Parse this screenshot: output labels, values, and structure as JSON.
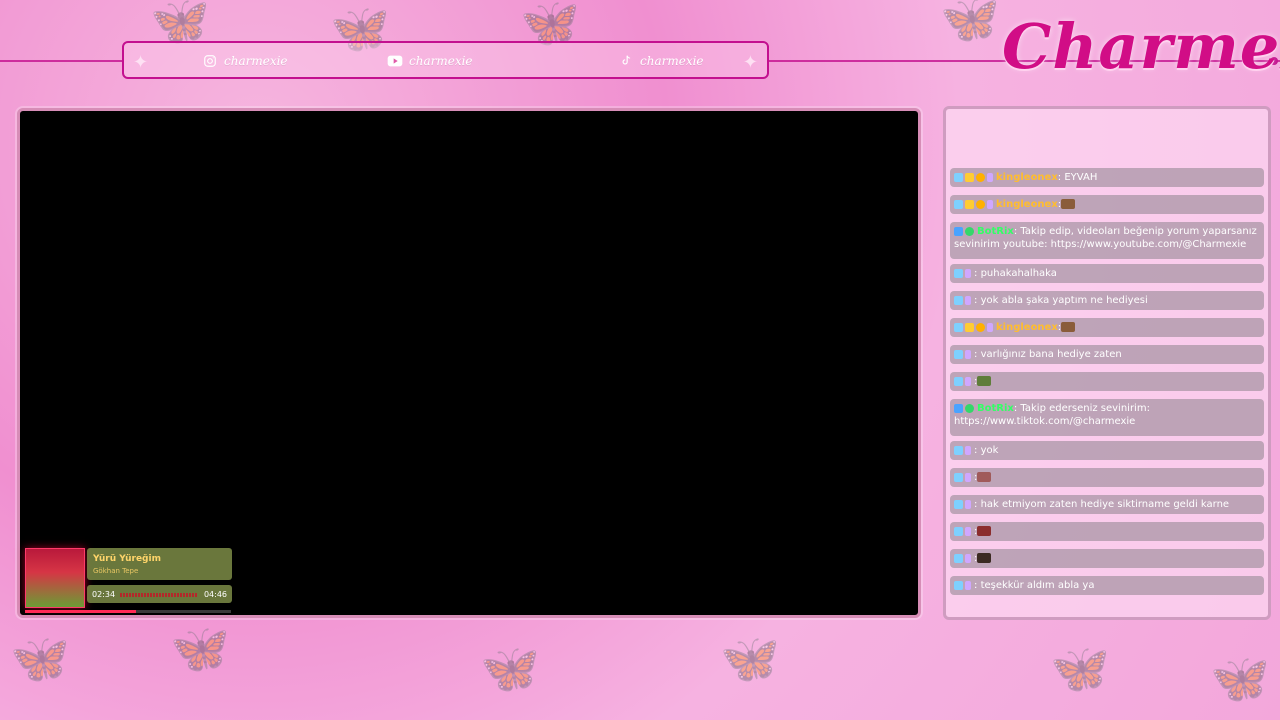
{
  "brand": {
    "name": "Charmexie"
  },
  "socials": [
    {
      "platform_icon": "instagram-icon",
      "handle": "charmexie"
    },
    {
      "platform_icon": "youtube-icon",
      "handle": "charmexie"
    },
    {
      "platform_icon": "tiktok-icon",
      "handle": "charmexie"
    }
  ],
  "chat": {
    "messages": [
      {
        "user": "kingleonex",
        "badges": [
          "sky",
          "gold",
          "orange",
          "lav"
        ],
        "user_color": "gold",
        "text": "EYVAH",
        "emote": false
      },
      {
        "user": "kingleonex",
        "badges": [
          "sky",
          "gold",
          "orange",
          "lav"
        ],
        "user_color": "gold",
        "text": "",
        "emote": true
      },
      {
        "user": "BotRix",
        "badges": [
          "blue",
          "green"
        ],
        "user_color": "green",
        "text": "Takip edip, videoları beğenip yorum yaparsanız sevinirim youtube: https://www.youtube.com/@Charmexie",
        "emote": false
      },
      {
        "user": "",
        "badges": [
          "sky",
          "lav"
        ],
        "user_color": "purple",
        "text": "puhakahalhaka",
        "emote": false
      },
      {
        "user": "",
        "badges": [
          "sky",
          "lav"
        ],
        "user_color": "purple",
        "text": "yok abla şaka yaptım ne hediyesi",
        "emote": false
      },
      {
        "user": "kingleonex",
        "badges": [
          "sky",
          "gold",
          "orange",
          "lav"
        ],
        "user_color": "gold",
        "text": "",
        "emote": true
      },
      {
        "user": "",
        "badges": [
          "sky",
          "lav"
        ],
        "user_color": "purple",
        "text": "varlığınız bana hediye zaten",
        "emote": false
      },
      {
        "user": "",
        "badges": [
          "sky",
          "lav"
        ],
        "user_color": "purple",
        "text": "",
        "emote": true
      },
      {
        "user": "BotRix",
        "badges": [
          "blue",
          "green"
        ],
        "user_color": "green",
        "text": "Takip ederseniz sevinirim: https://www.tiktok.com/@charmexie",
        "emote": false
      },
      {
        "user": "",
        "badges": [
          "sky",
          "lav"
        ],
        "user_color": "purple",
        "text": "yok",
        "emote": false
      },
      {
        "user": "",
        "badges": [
          "sky",
          "lav"
        ],
        "user_color": "purple",
        "text": "",
        "emote": true
      },
      {
        "user": "",
        "badges": [
          "sky",
          "lav"
        ],
        "user_color": "purple",
        "text": "hak etmiyom zaten hediye siktirname geldi karne",
        "emote": false
      },
      {
        "user": "",
        "badges": [
          "sky",
          "lav"
        ],
        "user_color": "purple",
        "text": "",
        "emote": true
      },
      {
        "user": "",
        "badges": [
          "sky",
          "lav"
        ],
        "user_color": "purple",
        "text": "",
        "emote": true
      },
      {
        "user": "",
        "badges": [
          "sky",
          "lav"
        ],
        "user_color": "purple",
        "text": "teşekkür aldım abla ya",
        "emote": false
      }
    ]
  },
  "music": {
    "title": "Yürü Yüreğim",
    "artist": "Gökhan Tepe",
    "elapsed": "02:34",
    "duration": "04:46",
    "progress_fraction": 0.54
  },
  "colors": {
    "accent": "#c3108f",
    "brand": "#d10d86"
  }
}
